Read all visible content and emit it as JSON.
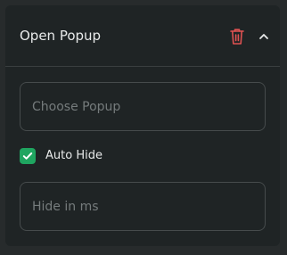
{
  "header": {
    "title": "Open Popup",
    "delete_icon": "trash-icon",
    "collapse_icon": "chevron-up-icon"
  },
  "popup_select": {
    "placeholder": "Choose Popup",
    "value": ""
  },
  "auto_hide": {
    "label": "Auto Hide",
    "checked": true
  },
  "hide_delay": {
    "placeholder": "Hide in ms",
    "value": ""
  },
  "colors": {
    "background": "#272b2c",
    "panel": "#1f2425",
    "checkbox_accent": "#1fa560",
    "delete_icon": "#e05252"
  }
}
